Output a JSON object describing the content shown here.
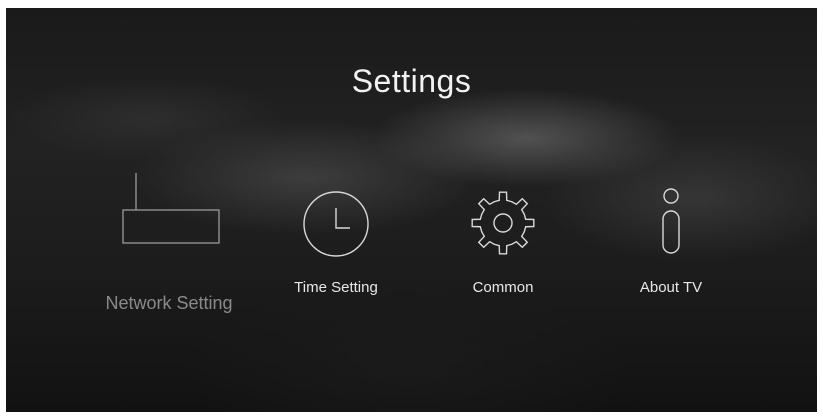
{
  "header": {
    "title": "Settings"
  },
  "menu": {
    "items": [
      {
        "label": "Network Setting",
        "icon": "router-icon"
      },
      {
        "label": "Time Setting",
        "icon": "clock-icon"
      },
      {
        "label": "Common",
        "icon": "gear-icon"
      },
      {
        "label": "About TV",
        "icon": "info-icon"
      }
    ]
  },
  "colors": {
    "background": "#1c1c1c",
    "text": "#e8e8e8",
    "dimmed_text": "#8a8a8a",
    "icon_stroke": "#d8d8d8"
  }
}
